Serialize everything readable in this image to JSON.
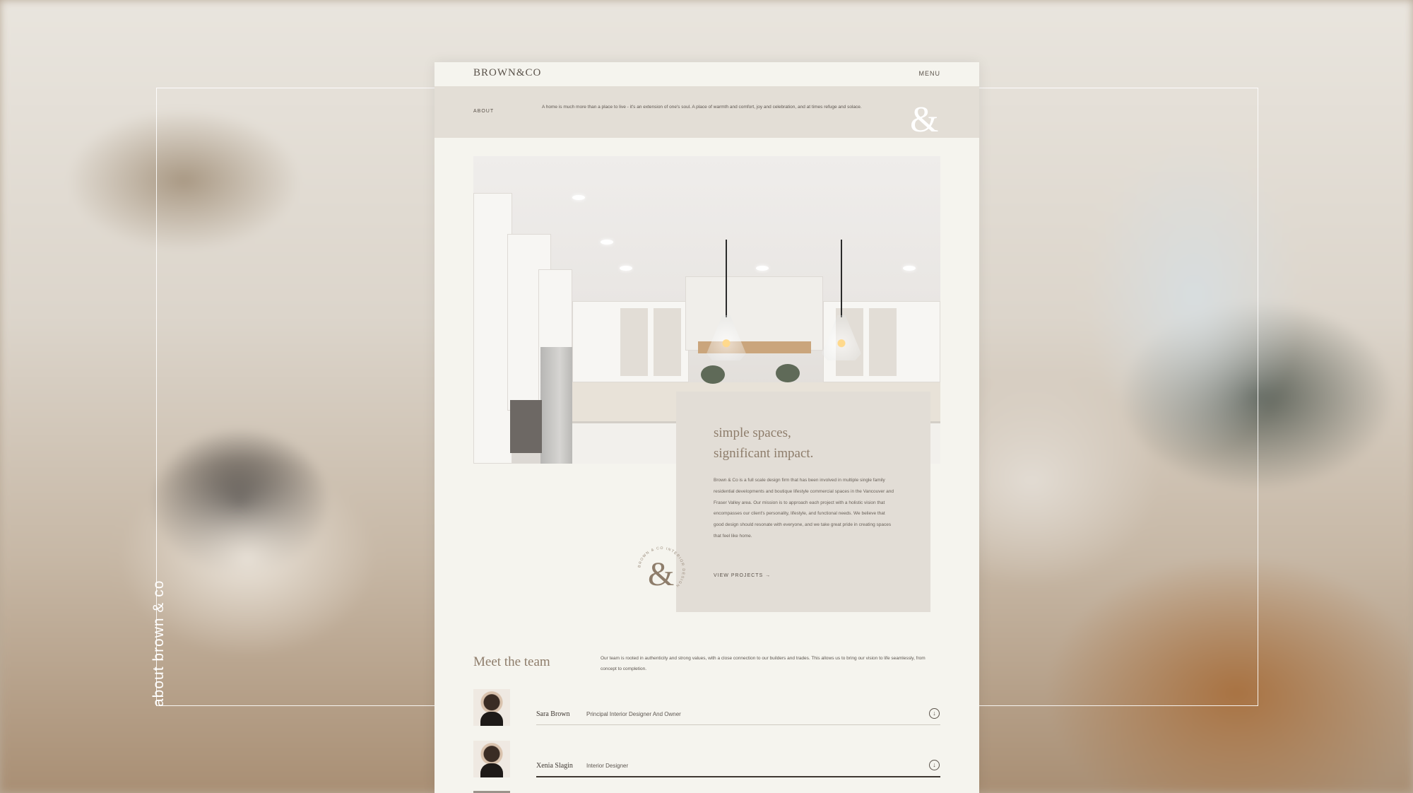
{
  "side_label": "about brown & co",
  "nav": {
    "logo": "BROWN&CO",
    "menu": "MENU"
  },
  "about": {
    "label": "ABOUT",
    "text": "A home is much more than a place to live - it's an extension of one's soul. A place of warmth and comfort, joy and celebration, and at times refuge and solace.",
    "ampersand": "&"
  },
  "hero_card": {
    "title_line1": "simple spaces,",
    "title_line2": "significant impact.",
    "body": "Brown & Co is a full scale design firm that has been involved in multiple single family residential developments and boutique lifestyle commercial spaces in the Vancouver and Fraser Valley area. Our mission is to approach each project with a holistic vision that encompasses our client's personality, lifestyle, and functional needs. We believe that good design should resonate with everyone, and we take great pride in creating spaces that feel like home.",
    "link": "VIEW PROJECTS →"
  },
  "badge": {
    "ampersand": "&",
    "ring_text": "BROWN & CO INTERIOR DESIGN"
  },
  "team": {
    "title": "Meet the team",
    "text": "Our team is rooted in authenticity and strong values, with a close connection to our builders and trades. This allows us to bring our vision to life seamlessly, from concept to completion.",
    "members": [
      {
        "name": "Sara Brown",
        "role": "Principal Interior Designer And Owner",
        "toggle": "↓"
      },
      {
        "name": "Xenia Slagin",
        "role": "Interior Designer",
        "toggle": "↓"
      }
    ]
  },
  "colors": {
    "page_bg": "#f5f4ee",
    "band_bg": "#e3ded6",
    "accent_text": "#8e7d6b",
    "dark_text": "#5a524a"
  }
}
